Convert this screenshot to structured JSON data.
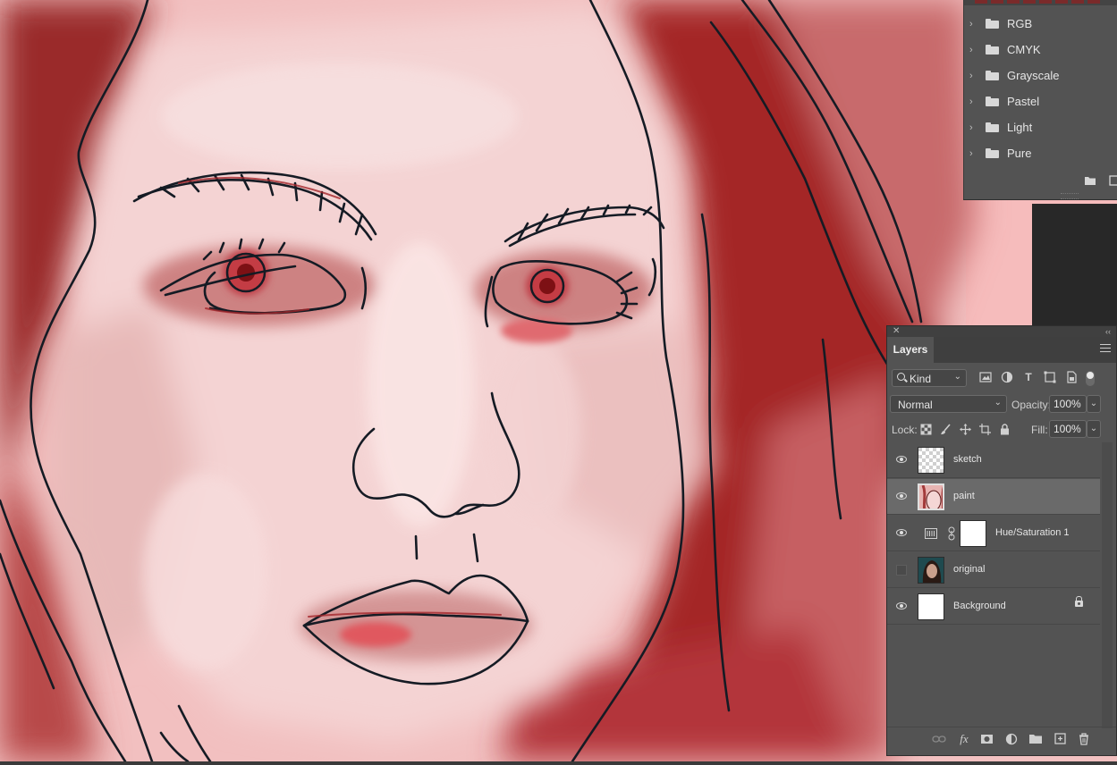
{
  "swatches_panel": {
    "groups": [
      {
        "label": "RGB"
      },
      {
        "label": "CMYK"
      },
      {
        "label": "Grayscale"
      },
      {
        "label": "Pastel"
      },
      {
        "label": "Light"
      },
      {
        "label": "Pure"
      }
    ]
  },
  "layers_panel": {
    "tab_label": "Layers",
    "filter": {
      "kind_label": "Kind"
    },
    "blend_mode": "Normal",
    "opacity_label": "Opacity:",
    "opacity_value": "100%",
    "lock_label": "Lock:",
    "fill_label": "Fill:",
    "fill_value": "100%",
    "layers": [
      {
        "name": "sketch",
        "visible": true,
        "selected": false
      },
      {
        "name": "paint",
        "visible": true,
        "selected": true
      },
      {
        "name": "Hue/Saturation 1",
        "visible": true,
        "selected": false
      },
      {
        "name": "original",
        "visible": false,
        "selected": false
      },
      {
        "name": "Background",
        "visible": true,
        "selected": false,
        "locked": true
      }
    ]
  },
  "colors": {
    "panel_bg": "#535353",
    "canvas_bg": "#f0c4c4",
    "ink": "#151b24",
    "blood_red": "#a3262b"
  }
}
